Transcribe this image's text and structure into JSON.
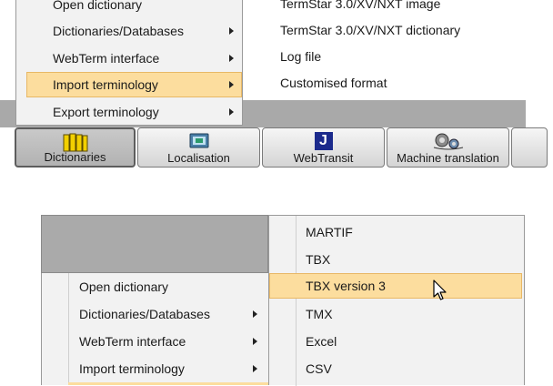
{
  "top": {
    "menu_items": [
      {
        "label": "Open dictionary",
        "has_submenu": false
      },
      {
        "label": "Dictionaries/Databases",
        "has_submenu": true
      },
      {
        "label": "WebTerm interface",
        "has_submenu": true
      },
      {
        "label": "Import terminology",
        "has_submenu": true,
        "highlighted": true
      },
      {
        "label": "Export terminology",
        "has_submenu": true
      }
    ],
    "submenu_items": [
      {
        "label": "TermStar 3.0/XV/NXT image"
      },
      {
        "label": "TermStar 3.0/XV/NXT dictionary"
      },
      {
        "label": "Log file"
      },
      {
        "label": "Customised format"
      }
    ],
    "tabs": [
      {
        "label": "Dictionaries",
        "icon": "dictionaries-icon",
        "active": true
      },
      {
        "label": "Localisation",
        "icon": "localisation-icon"
      },
      {
        "label": "WebTransit",
        "icon": "webtransit-icon",
        "icon_text": "J"
      },
      {
        "label": "Machine translation",
        "icon": "machine-translation-icon"
      }
    ]
  },
  "bottom": {
    "menu_items": [
      {
        "label": "Open dictionary",
        "has_submenu": false
      },
      {
        "label": "Dictionaries/Databases",
        "has_submenu": true
      },
      {
        "label": "WebTerm interface",
        "has_submenu": true
      },
      {
        "label": "Import terminology",
        "has_submenu": true
      }
    ],
    "submenu_items": [
      {
        "label": "MARTIF"
      },
      {
        "label": "TBX"
      },
      {
        "label": "TBX version 3",
        "highlighted": true
      },
      {
        "label": "TMX"
      },
      {
        "label": "Excel"
      },
      {
        "label": "CSV"
      }
    ]
  },
  "colors": {
    "highlight": "#fcdd9e",
    "highlight_border": "#e8b866",
    "menu_bg": "#f2f2f2",
    "strip_grey": "#a9a9a9",
    "panel_grey": "#aaaaaa"
  }
}
